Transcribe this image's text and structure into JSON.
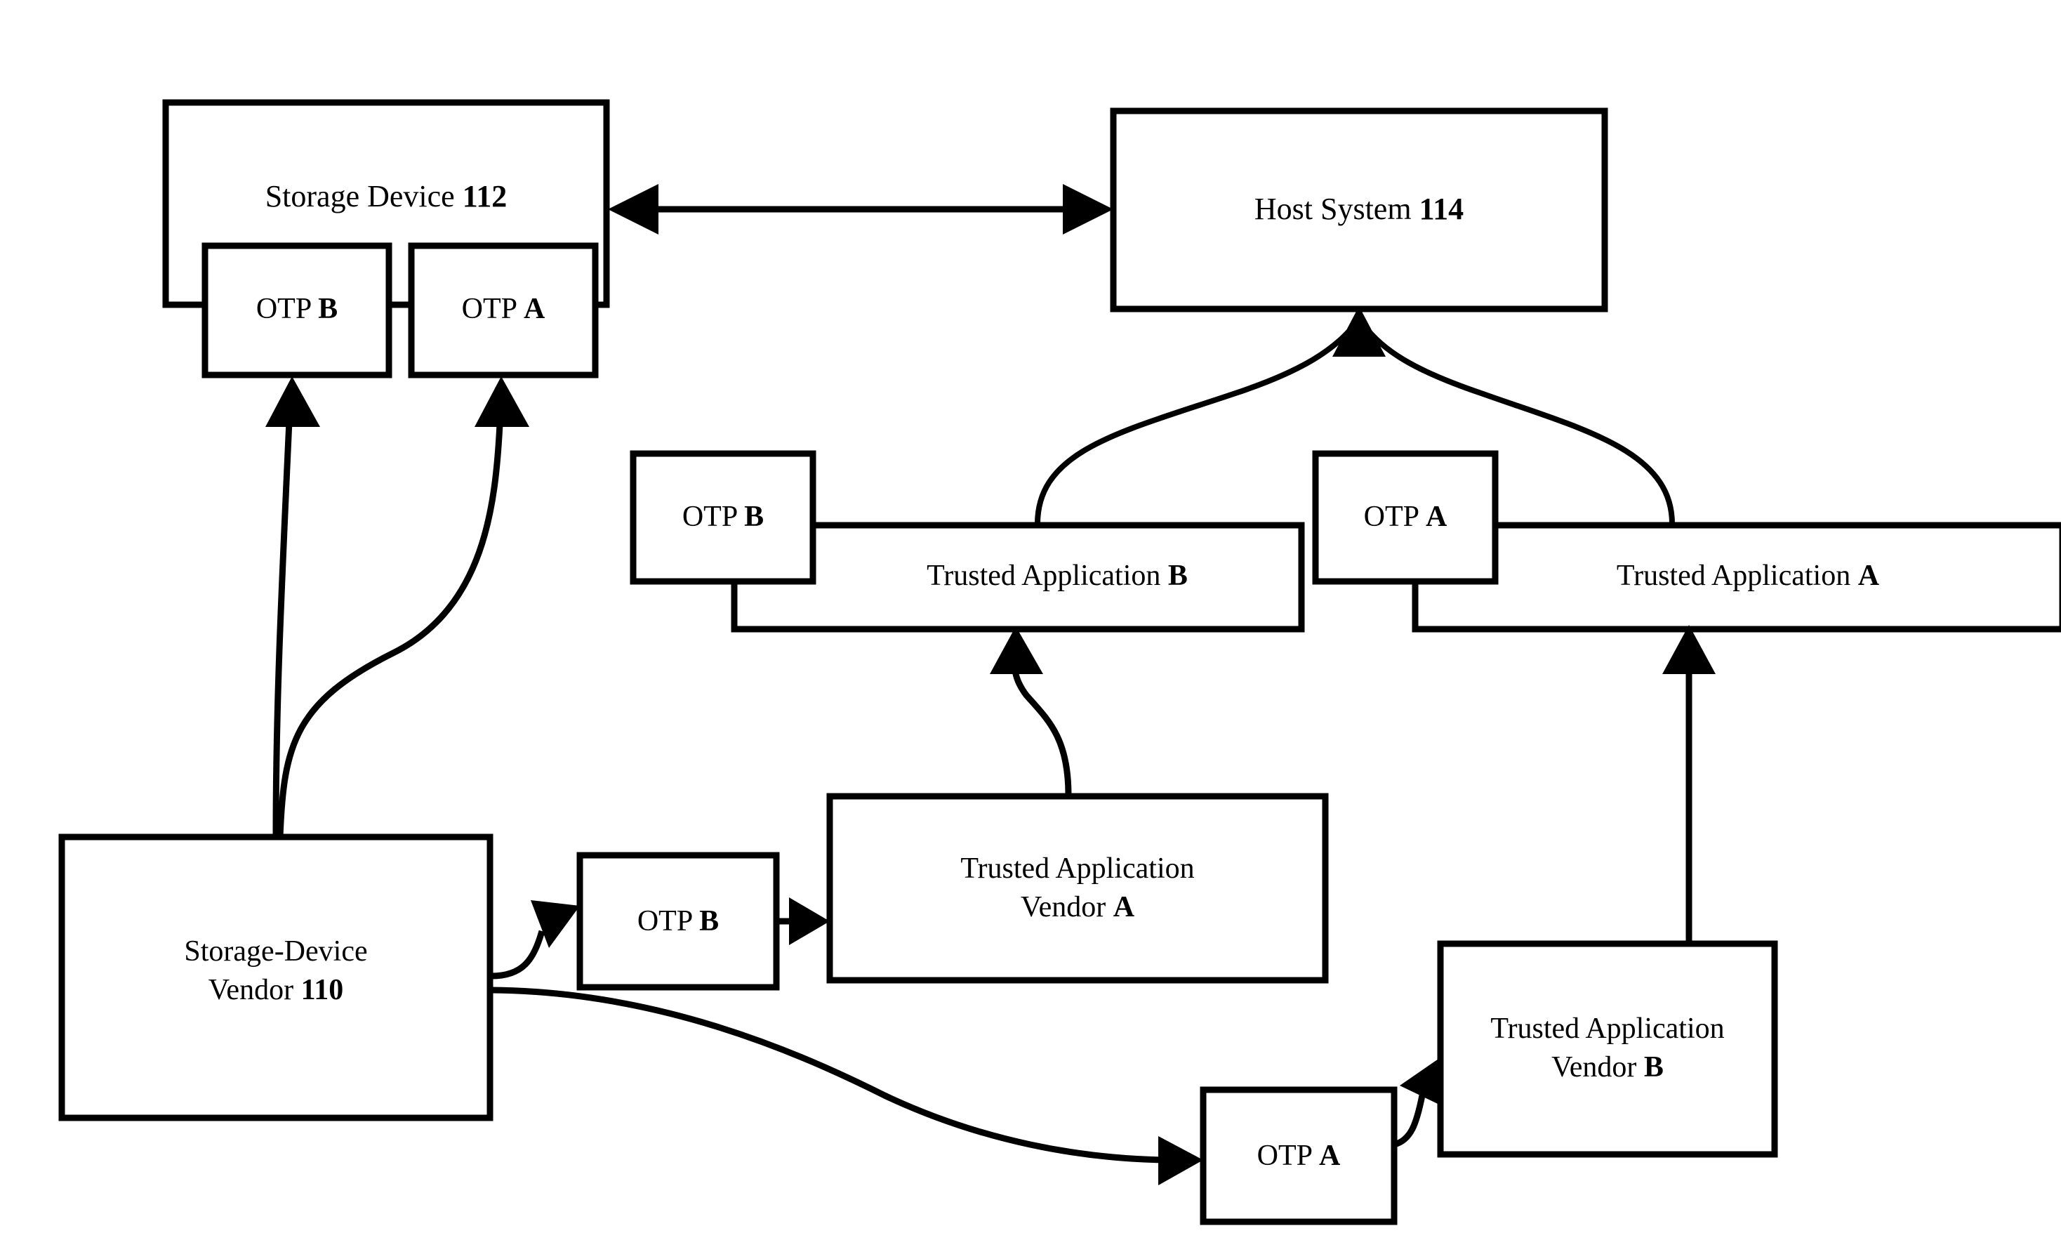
{
  "figure": {
    "type": "block-diagram",
    "background_color": "#ffffff",
    "line_color": "#000000"
  },
  "nodes": {
    "storage_device": {
      "label": "Storage Device ",
      "ref": "112"
    },
    "host_system": {
      "label": "Host System ",
      "ref": "114"
    },
    "otp_b_device": {
      "label": "OTP ",
      "ref": "B"
    },
    "otp_a_device": {
      "label": "OTP ",
      "ref": "A"
    },
    "otp_b_app": {
      "label": "OTP ",
      "ref": "B"
    },
    "otp_a_app": {
      "label": "OTP ",
      "ref": "A"
    },
    "trusted_application_b": {
      "label": "Trusted Application ",
      "ref": "B"
    },
    "trusted_application_a": {
      "label": "Trusted Application ",
      "ref": "A"
    },
    "storage_device_vendor": {
      "line1": "Storage-Device",
      "line2": "Vendor ",
      "ref": "110"
    },
    "otp_b_vendor": {
      "label": "OTP ",
      "ref": "B"
    },
    "otp_a_vendor": {
      "label": "OTP ",
      "ref": "A"
    },
    "trusted_application_vendor_a": {
      "line1": "Trusted Application",
      "line2": "Vendor ",
      "ref": "A"
    },
    "trusted_application_vendor_b": {
      "line1": "Trusted Application",
      "line2": "Vendor ",
      "ref": "B"
    }
  },
  "connectors": [
    {
      "name": "storage-device-to-host-system",
      "from": "storage_device",
      "to": "host_system",
      "style": "double-headed-straight"
    },
    {
      "name": "vendor-to-otp-b-device",
      "from": "storage_device_vendor",
      "to": "otp_b_device",
      "style": "curved-arrow"
    },
    {
      "name": "vendor-to-otp-a-device",
      "from": "storage_device_vendor",
      "to": "otp_a_device",
      "style": "curved-arrow"
    },
    {
      "name": "trusted-application-b-to-host-system",
      "from": "trusted_application_b",
      "to": "host_system",
      "style": "curved-arrow"
    },
    {
      "name": "trusted-application-a-to-host-system",
      "from": "trusted_application_a",
      "to": "host_system",
      "style": "curved-arrow"
    },
    {
      "name": "ta-vendor-a-to-trusted-application-b",
      "from": "trusted_application_vendor_a",
      "to": "trusted_application_b",
      "style": "curved-arrow"
    },
    {
      "name": "ta-vendor-b-to-trusted-application-a",
      "from": "trusted_application_vendor_b",
      "to": "trusted_application_a",
      "style": "straight-arrow"
    },
    {
      "name": "vendor-to-otp-b-vendor",
      "from": "storage_device_vendor",
      "to": "otp_b_vendor",
      "style": "curved-arrow"
    },
    {
      "name": "otp-b-vendor-to-ta-vendor-a",
      "from": "otp_b_vendor",
      "to": "trusted_application_vendor_a",
      "style": "straight-arrow"
    },
    {
      "name": "vendor-to-otp-a-vendor",
      "from": "storage_device_vendor",
      "to": "otp_a_vendor",
      "style": "curved-arrow"
    },
    {
      "name": "otp-a-vendor-to-ta-vendor-b",
      "from": "otp_a_vendor",
      "to": "trusted_application_vendor_b",
      "style": "curved-arrow"
    }
  ]
}
